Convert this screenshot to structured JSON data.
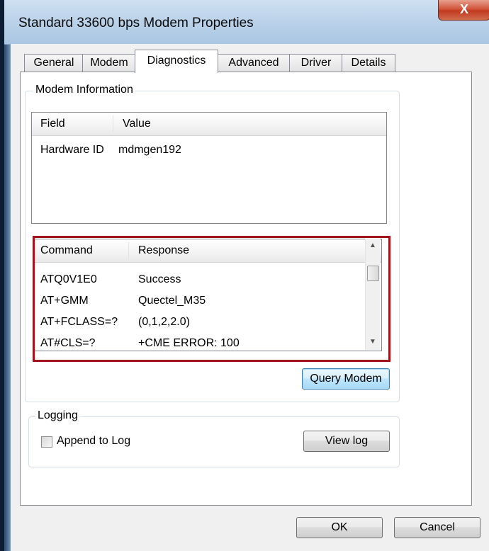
{
  "window": {
    "title": "Standard 33600 bps Modem Properties",
    "close_glyph": "X"
  },
  "tabs": [
    {
      "label": "General",
      "active": false
    },
    {
      "label": "Modem",
      "active": false
    },
    {
      "label": "Diagnostics",
      "active": true
    },
    {
      "label": "Advanced",
      "active": false
    },
    {
      "label": "Driver",
      "active": false
    },
    {
      "label": "Details",
      "active": false
    }
  ],
  "modem_info": {
    "group_label": "Modem Information",
    "columns": [
      "Field",
      "Value"
    ],
    "rows": [
      {
        "field": "Hardware ID",
        "value": "mdmgen192"
      }
    ]
  },
  "diagnostics": {
    "columns": [
      "Command",
      "Response"
    ],
    "rows": [
      {
        "command": "ATQ0V1E0",
        "response": "Success"
      },
      {
        "command": "AT+GMM",
        "response": "Quectel_M35"
      },
      {
        "command": "AT+FCLASS=?",
        "response": "(0,1,2,2.0)"
      },
      {
        "command": "AT#CLS=?",
        "response": "+CME ERROR: 100"
      }
    ],
    "query_button": "Query Modem"
  },
  "logging": {
    "group_label": "Logging",
    "append_label": "Append to Log",
    "append_checked": false,
    "view_log_button": "View log"
  },
  "footer": {
    "ok": "OK",
    "cancel": "Cancel"
  },
  "colors": {
    "highlight": "#a0151c",
    "focus_border": "#3c7fb1"
  }
}
